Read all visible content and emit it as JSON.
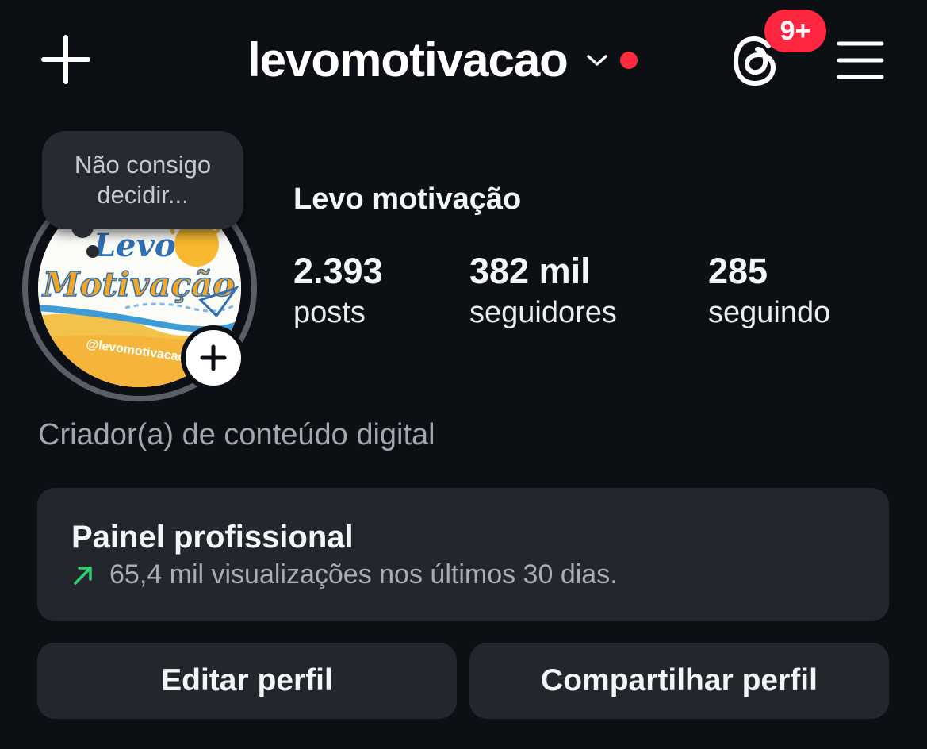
{
  "header": {
    "username": "levomotivacao",
    "notification_badge": "9+",
    "badge_color": "#ff2640",
    "dot_color": "#ff2b3d",
    "icons": [
      "plus-icon",
      "chevron-down-icon",
      "threads-icon",
      "menu-icon"
    ]
  },
  "profile": {
    "note_line1": "Não consigo",
    "note_line2": "decidir...",
    "display_name": "Levo motivação",
    "avatar_logo_line1": "Levo",
    "avatar_logo_line2": "Motivação",
    "avatar_handle": "@levomotivacao",
    "stats": [
      {
        "value": "2.393",
        "label": "posts"
      },
      {
        "value": "382 mil",
        "label": "seguidores"
      },
      {
        "value": "285",
        "label": "seguindo"
      }
    ],
    "category": "Criador(a) de conteúdo digital"
  },
  "dashboard": {
    "title": "Painel profissional",
    "subtitle": "65,4 mil visualizações nos últimos 30 dias.",
    "trend_color": "#2fd06f"
  },
  "actions": {
    "edit_label": "Editar perfil",
    "share_label": "Compartilhar perfil"
  }
}
